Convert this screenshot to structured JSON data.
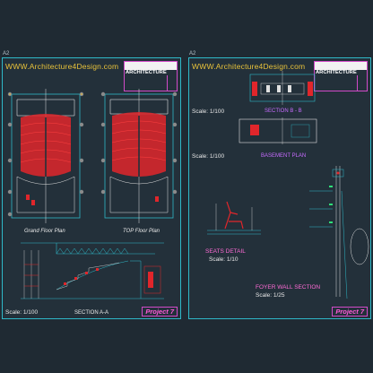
{
  "left_sheet": {
    "sheet_id": "A2",
    "url": "WWW.Architecture4Design.com",
    "brand": "ARCHITECTURE",
    "labels": {
      "ground_floor": "Grand Floor Plan",
      "top_floor": "TOP Floor Plan",
      "section": "SECTION A-A",
      "scale": "Scale: 1/100"
    },
    "project": "Project 7"
  },
  "right_sheet": {
    "sheet_id": "A2",
    "url": "WWW.Architecture4Design.com",
    "brand": "ARCHITECTURE",
    "labels": {
      "section_b": "SECTION B - B",
      "scale_top": "Scale: 1/100",
      "basement": "BASEMENT PLAN",
      "scale_mid": "Scale: 1/100",
      "seats_detail": "SEATS DETAIL",
      "seats_scale": "Scale: 1/10",
      "foyer": "FOYER WALL SECTION",
      "foyer_scale": "Scale: 1/25"
    },
    "project": "Project 7"
  },
  "colors": {
    "background": "#1f2a33",
    "sheet_border": "#2fb8c8",
    "url_text": "#e8c23a",
    "seats": "#e0262b",
    "magenta": "#d14ac8"
  }
}
